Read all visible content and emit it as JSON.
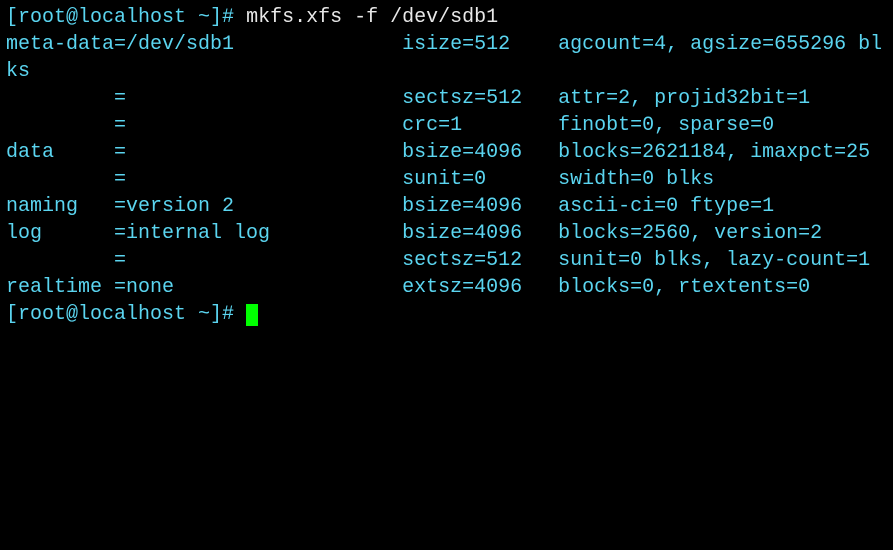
{
  "prompt1_open": "[",
  "prompt1_user": "root@localhost ~",
  "prompt1_close": "]# ",
  "command": "mkfs.xfs -f /dev/sdb1",
  "output_block": "meta-data=/dev/sdb1              isize=512    agcount=4, agsize=655296 blks\n         =                       sectsz=512   attr=2, projid32bit=1\n         =                       crc=1        finobt=0, sparse=0\ndata     =                       bsize=4096   blocks=2621184, imaxpct=25\n         =                       sunit=0      swidth=0 blks\nnaming   =version 2              bsize=4096   ascii-ci=0 ftype=1\nlog      =internal log           bsize=4096   blocks=2560, version=2\n         =                       sectsz=512   sunit=0 blks, lazy-count=1\nrealtime =none                   extsz=4096   blocks=0, rtextents=0",
  "prompt2_open": "[",
  "prompt2_user": "root@localhost ~",
  "prompt2_close": "]# "
}
